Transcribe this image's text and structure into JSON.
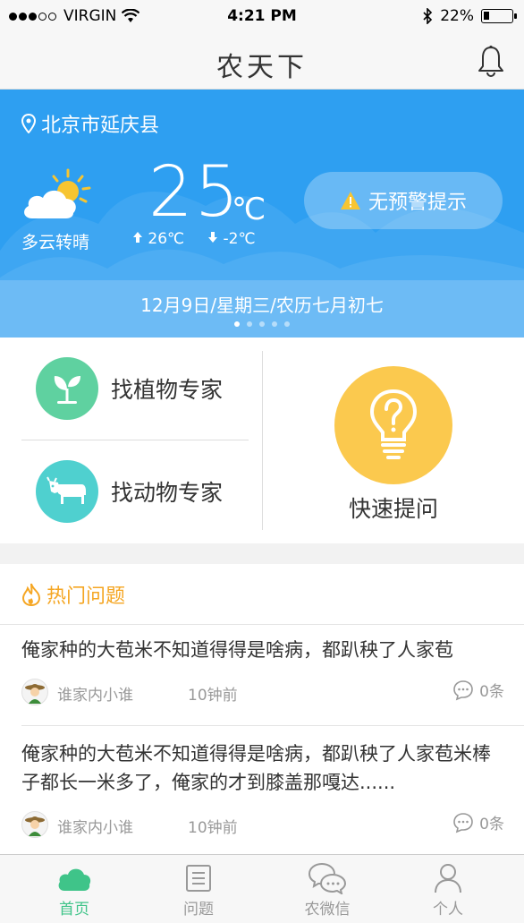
{
  "status_bar": {
    "carrier": "VIRGIN",
    "time": "4:21 PM",
    "battery": "22%",
    "battery_fraction": 0.22
  },
  "nav": {
    "title": "农天下"
  },
  "weather": {
    "location": "北京市延庆县",
    "condition": "多云转晴",
    "temperature": "25",
    "unit": "℃",
    "high": "26℃",
    "low": "-2℃",
    "alert": "无预警提示",
    "date": "12月9日/星期三/农历七月初七",
    "page_count": 5,
    "page_active": 1
  },
  "services": {
    "plant_expert": "找植物专家",
    "animal_expert": "找动物专家",
    "quick_ask": "快速提问"
  },
  "hot": {
    "title": "热门问题",
    "questions": [
      {
        "text": "俺家种的大苞米不知道得得是啥病，都趴秧了人家苞",
        "user": "谁家内小谁",
        "time": "10钟前",
        "comments": "0条"
      },
      {
        "text": "俺家种的大苞米不知道得得是啥病，都趴秧了人家苞米棒子都长一米多了，俺家的才到膝盖那嘎达......",
        "user": "谁家内小谁",
        "time": "10钟前",
        "comments": "0条"
      }
    ]
  },
  "tabs": [
    {
      "label": "首页",
      "icon": "cloud-icon",
      "active": true
    },
    {
      "label": "问题",
      "icon": "list-icon",
      "active": false
    },
    {
      "label": "农微信",
      "icon": "chat-icon",
      "active": false
    },
    {
      "label": "个人",
      "icon": "person-icon",
      "active": false
    }
  ],
  "colors": {
    "accent": "#3fc489",
    "hero": "#2e9ff1",
    "hot": "#f5a623",
    "quick": "#fbc94e",
    "plant": "#5fd1a0",
    "animal": "#4fd0cf"
  }
}
